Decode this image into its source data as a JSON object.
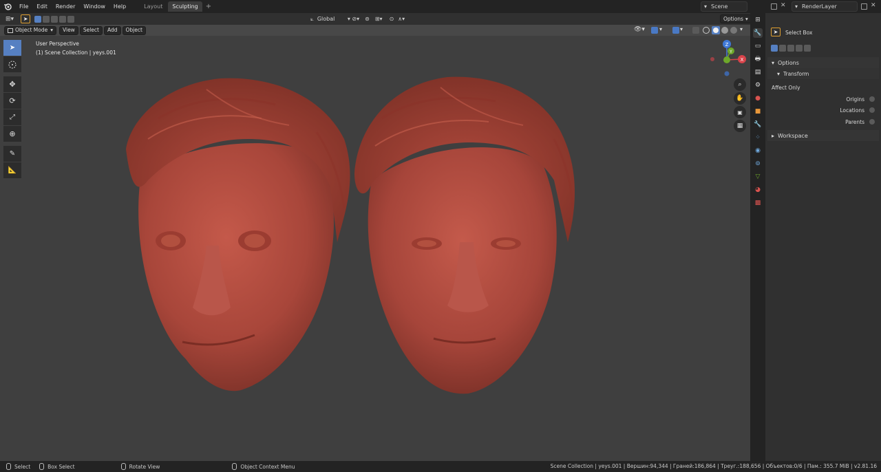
{
  "menubar": {
    "items": [
      "File",
      "Edit",
      "Render",
      "Window",
      "Help"
    ],
    "tabs": [
      {
        "label": "Layout",
        "active": false
      },
      {
        "label": "Sculpting",
        "active": true
      }
    ],
    "add_tab": "+",
    "scene": "Scene",
    "render_layer": "RenderLayer"
  },
  "header": {
    "orientation": "Global",
    "options": "Options"
  },
  "viewport_menu": {
    "mode": "Object Mode",
    "items": [
      "View",
      "Select",
      "Add",
      "Object"
    ]
  },
  "viewport": {
    "perspective": "User Perspective",
    "collection": "(1) Scene Collection | yeys.001",
    "background_color": "#3f3f3f",
    "model_color": "#a8463a",
    "gizmo": {
      "z": "Z",
      "y": "Y",
      "x": "X"
    }
  },
  "toolbar": {
    "tools": [
      "select-box",
      "cursor",
      "move",
      "rotate",
      "scale",
      "transform",
      "annotate",
      "measure"
    ]
  },
  "properties": {
    "tool_name": "Select Box",
    "options_label": "Options",
    "transform_label": "Transform",
    "affect_only": "Affect Only",
    "checks": [
      "Origins",
      "Locations",
      "Parents"
    ],
    "workspace": "Workspace"
  },
  "statusbar": {
    "select": "Select",
    "box_select": "Box Select",
    "rotate_view": "Rotate View",
    "context_menu": "Object Context Menu",
    "stats": "Scene Collection | yeys.001 | Вершин:94,344 | Граней:186,864 | Треуг.:188,656 | Объектов:0/6 | Пам.: 355.7 MiB | v2.81.16"
  }
}
